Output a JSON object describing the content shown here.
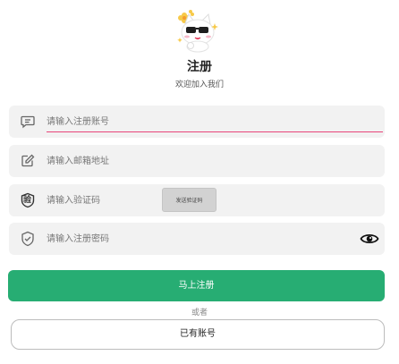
{
  "header": {
    "logo_icon": "cat-with-sunglasses-icon",
    "title": "注册",
    "subtitle": "欢迎加入我们"
  },
  "form": {
    "account": {
      "icon": "message-square-icon",
      "placeholder": "请输入注册账号",
      "value": ""
    },
    "email": {
      "icon": "edit-icon",
      "placeholder": "请输入邮箱地址",
      "value": ""
    },
    "code": {
      "icon": "shield-verify-icon",
      "icon_char": "验",
      "placeholder": "请输入验证码",
      "value": "",
      "send_button": "发送验证码"
    },
    "password": {
      "icon": "shield-check-icon",
      "placeholder": "请输入注册密码",
      "value": "",
      "toggle_icon": "eye-icon"
    }
  },
  "actions": {
    "register": "马上注册",
    "or": "或者",
    "have_account": "已有账号"
  },
  "colors": {
    "primary": "#27ad73",
    "focus_underline": "#e8457a",
    "field_bg": "#f2f2f2"
  }
}
